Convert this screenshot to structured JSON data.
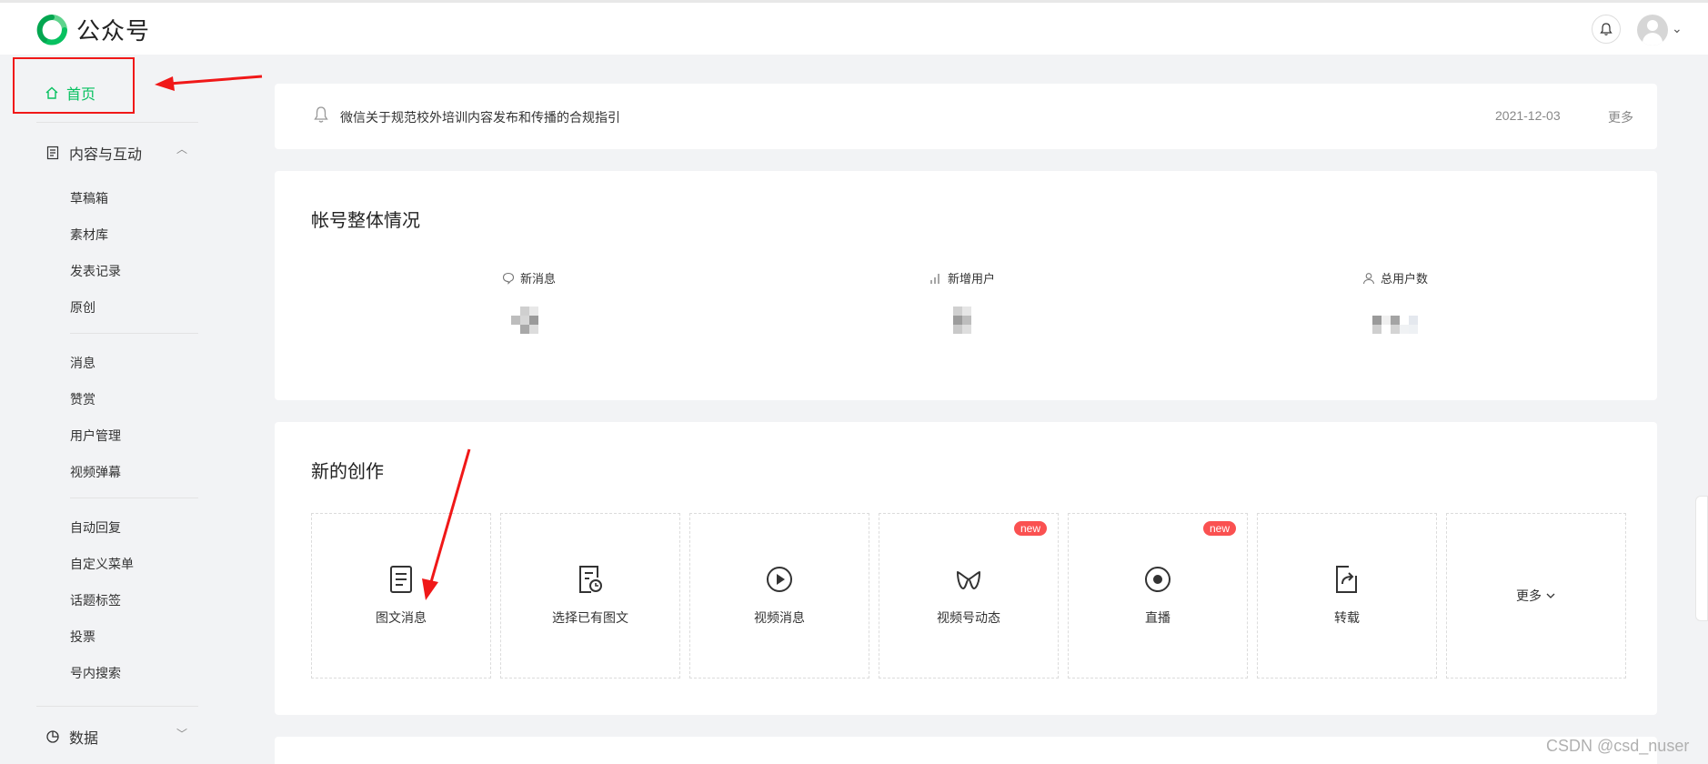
{
  "app": {
    "title": "公众号"
  },
  "header": {
    "bell_icon": "bell-icon",
    "avatar_icon": "user-avatar-icon"
  },
  "sidebar": {
    "home": {
      "label": "首页",
      "icon": "home-icon"
    },
    "content_group": {
      "label": "内容与互动",
      "icon": "document-icon",
      "expanded": true
    },
    "content_items": [
      {
        "label": "草稿箱"
      },
      {
        "label": "素材库"
      },
      {
        "label": "发表记录"
      },
      {
        "label": "原创"
      }
    ],
    "interaction_items": [
      {
        "label": "消息"
      },
      {
        "label": "赞赏"
      },
      {
        "label": "用户管理"
      },
      {
        "label": "视频弹幕"
      }
    ],
    "feature_items": [
      {
        "label": "自动回复"
      },
      {
        "label": "自定义菜单"
      },
      {
        "label": "话题标签"
      },
      {
        "label": "投票"
      },
      {
        "label": "号内搜索"
      }
    ],
    "data_group": {
      "label": "数据",
      "icon": "pie-chart-icon",
      "expanded": false
    }
  },
  "notice": {
    "text": "微信关于规范校外培训内容发布和传播的合规指引",
    "date": "2021-12-03",
    "more": "更多"
  },
  "overview": {
    "title": "帐号整体情况",
    "stats": [
      {
        "label": "新消息",
        "icon": "chat-bubble-icon"
      },
      {
        "label": "新增用户",
        "icon": "bar-chart-icon"
      },
      {
        "label": "总用户数",
        "icon": "users-icon"
      }
    ]
  },
  "create": {
    "title": "新的创作",
    "tiles": [
      {
        "label": "图文消息",
        "icon": "article-icon"
      },
      {
        "label": "选择已有图文",
        "icon": "article-clock-icon"
      },
      {
        "label": "视频消息",
        "icon": "play-circle-icon"
      },
      {
        "label": "视频号动态",
        "icon": "channels-icon",
        "badge": "new"
      },
      {
        "label": "直播",
        "icon": "live-record-icon",
        "badge": "new"
      },
      {
        "label": "转载",
        "icon": "repost-icon"
      }
    ],
    "more": "更多"
  },
  "watermark": "CSDN @csd_nuser",
  "colors": {
    "brand": "#07c160",
    "badge": "#fa5151",
    "annotation": "#f01818"
  }
}
